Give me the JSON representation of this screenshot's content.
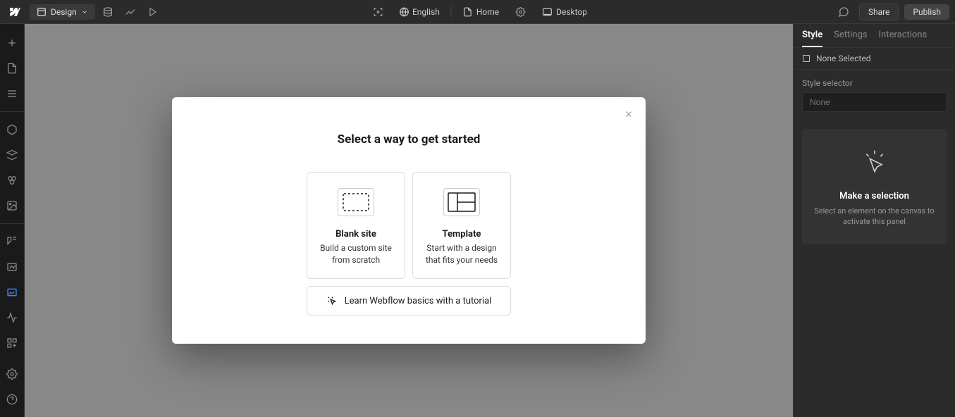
{
  "topbar": {
    "mode_label": "Design",
    "language": "English",
    "home_label": "Home",
    "viewport_label": "Desktop",
    "share_label": "Share",
    "publish_label": "Publish"
  },
  "right_panel": {
    "tabs": {
      "style": "Style",
      "settings": "Settings",
      "interactions": "Interactions"
    },
    "none_selected": "None Selected",
    "selector_label": "Style selector",
    "selector_placeholder": "None",
    "empty": {
      "title": "Make a selection",
      "desc": "Select an element on the canvas to activate this panel"
    }
  },
  "modal": {
    "title": "Select a way to get started",
    "options": {
      "blank": {
        "title": "Blank site",
        "desc": "Build a custom site from scratch"
      },
      "template": {
        "title": "Template",
        "desc": "Start with a design that fits your needs"
      }
    },
    "tutorial_label": "Learn Webflow basics with a tutorial"
  }
}
